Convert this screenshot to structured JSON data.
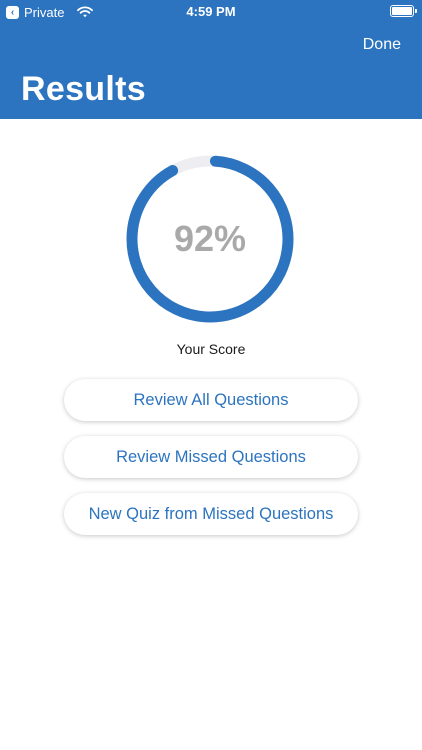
{
  "status_bar": {
    "back_glyph": "‹",
    "carrier": "Private",
    "time": "4:59 PM",
    "wifi_icon": "wifi-icon",
    "battery_icon": "battery-icon"
  },
  "header": {
    "done_label": "Done",
    "title": "Results"
  },
  "score": {
    "value_text": "92%",
    "fraction": 0.92,
    "label": "Your Score"
  },
  "buttons": [
    {
      "label": "Review All Questions"
    },
    {
      "label": "Review Missed Questions"
    },
    {
      "label": "New Quiz from Missed Questions"
    }
  ],
  "colors": {
    "accent": "#2c74bf",
    "track": "#eeeef2",
    "score_text": "#a9a9a9"
  }
}
